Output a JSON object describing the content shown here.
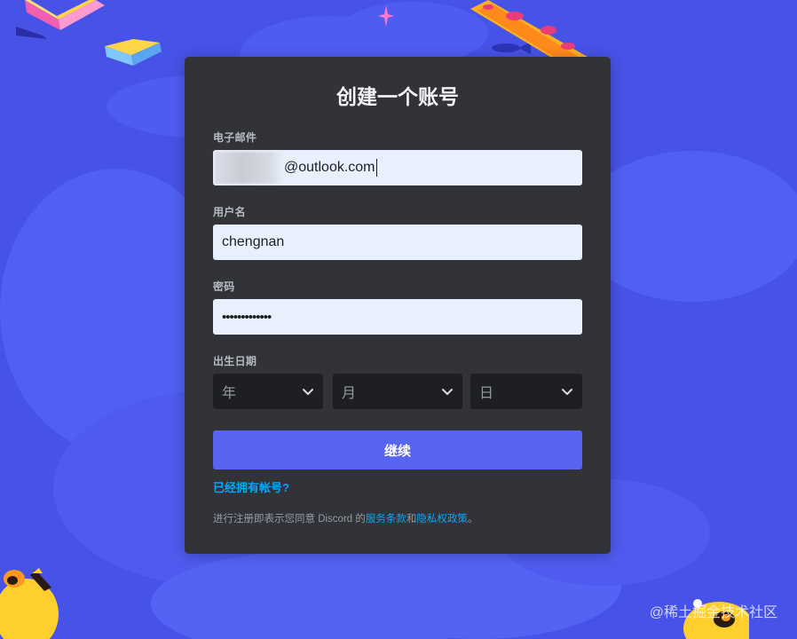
{
  "form": {
    "title": "创建一个账号",
    "email": {
      "label": "电子邮件",
      "value": "@outlook.com"
    },
    "username": {
      "label": "用户名",
      "value": "chengnan"
    },
    "password": {
      "label": "密码",
      "value": "•••••••••••••"
    },
    "dob": {
      "label": "出生日期",
      "year": "年",
      "month": "月",
      "day": "日"
    },
    "submit_label": "继续",
    "login_link": "已经拥有帐号?",
    "terms": {
      "prefix": "进行注册即表示您同意 Discord 的",
      "tos": "服务条款",
      "and": "和",
      "privacy": "隐私权政策",
      "suffix": "。"
    }
  },
  "watermark": "@稀土掘金技术社区",
  "colors": {
    "background": "#4752e6",
    "card": "#313338",
    "input": "#e8effd",
    "select": "#1e1f22",
    "button": "#5865f2",
    "link": "#00a8fc"
  },
  "icons": [
    "chevron-down-icon",
    "book-icon",
    "pizza-icon",
    "sparkle-icon",
    "fish-icon",
    "duck-icon"
  ]
}
